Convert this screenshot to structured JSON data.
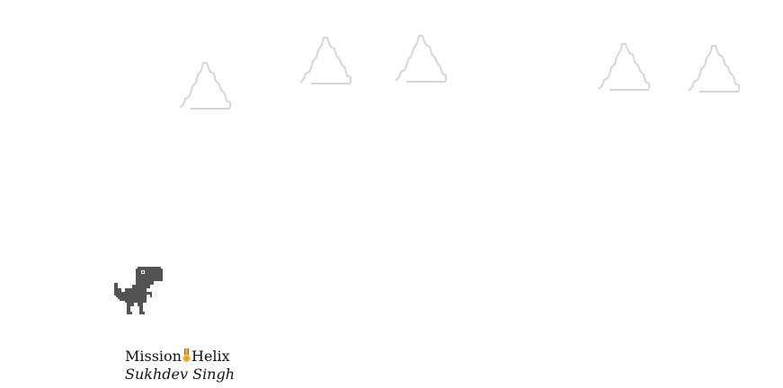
{
  "game": {
    "name": "chrome-dino-runner",
    "colors": {
      "background": "#ffffff",
      "cloud": "#d6d6d6",
      "dino": "#535353"
    },
    "clouds_visible": 5
  },
  "caption": {
    "title_left": "Mission",
    "title_icon": "medal-icon",
    "title_right": "Helix",
    "author": "Sukhdev Singh"
  }
}
